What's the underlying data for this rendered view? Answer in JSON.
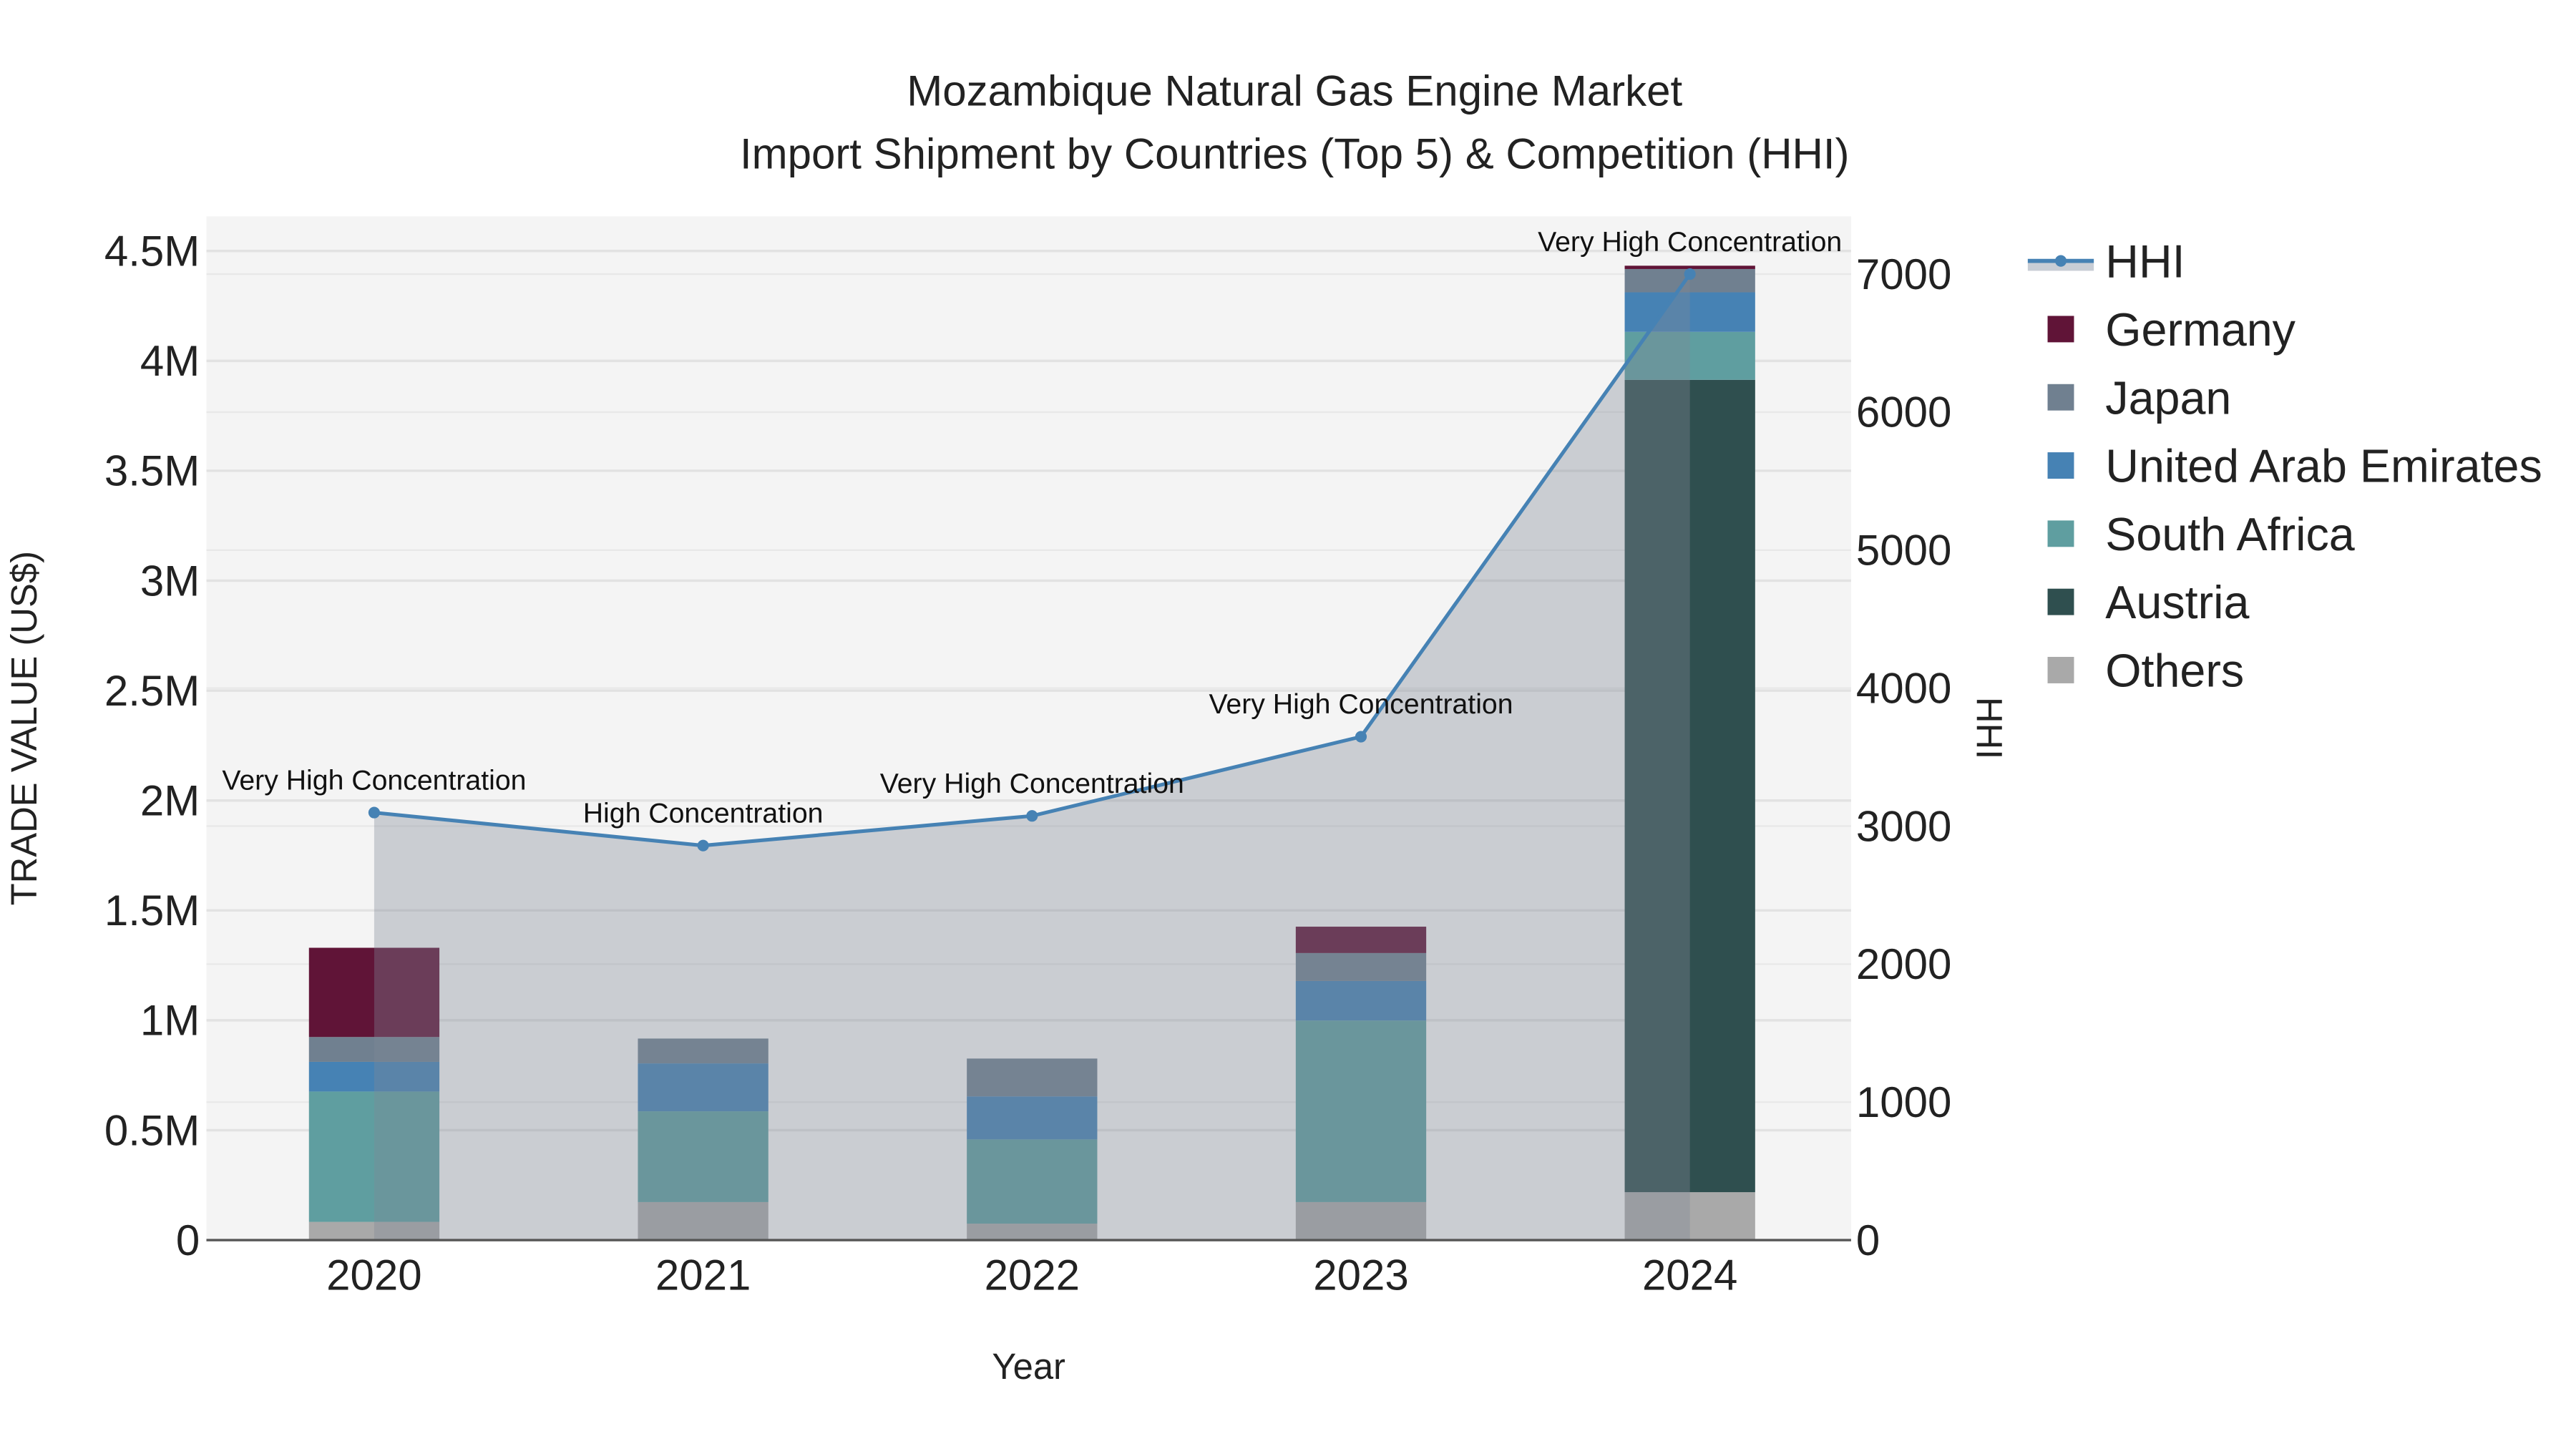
{
  "chart_data": {
    "type": "bar",
    "title": "Mozambique Natural Gas Engine Market",
    "subtitle": "Import Shipment by Countries (Top 5) & Competition (HHI)",
    "xlabel": "Year",
    "ylabel": "TRADE VALUE (US$)",
    "y2label": "HHI",
    "categories": [
      "2020",
      "2021",
      "2022",
      "2023",
      "2024"
    ],
    "ylim": [
      0,
      4650000
    ],
    "y2lim": [
      0,
      7400
    ],
    "yticks": [
      0,
      500000,
      1000000,
      1500000,
      2000000,
      2500000,
      3000000,
      3500000,
      4000000,
      4500000
    ],
    "yticklabels": [
      "0",
      "0.5M",
      "1M",
      "1.5M",
      "2M",
      "2.5M",
      "3M",
      "3.5M",
      "4M",
      "4.5M"
    ],
    "y2ticks": [
      0,
      1000,
      2000,
      3000,
      4000,
      5000,
      6000,
      7000
    ],
    "y2ticklabels": [
      "0",
      "1000",
      "2000",
      "3000",
      "4000",
      "5000",
      "6000",
      "7000"
    ],
    "grid": true,
    "legend_position": "right",
    "stacked_series": [
      {
        "name": "Others",
        "color": "#A9A9A9",
        "values": [
          83000,
          173000,
          75000,
          173000,
          218000
        ]
      },
      {
        "name": "Austria",
        "color": "#2F4F4F",
        "values": [
          0,
          0,
          0,
          0,
          3696000
        ]
      },
      {
        "name": "South Africa",
        "color": "#5F9EA0",
        "values": [
          593000,
          413000,
          383000,
          826000,
          218000
        ]
      },
      {
        "name": "United Arab Emirates",
        "color": "#4682B4",
        "values": [
          135000,
          218000,
          196000,
          180000,
          180000
        ]
      },
      {
        "name": "Japan",
        "color": "#708090",
        "values": [
          113000,
          113000,
          172000,
          127000,
          106000
        ]
      },
      {
        "name": "Germany",
        "color": "#601437",
        "values": [
          406000,
          0,
          0,
          120000,
          15000
        ]
      }
    ],
    "line_series": {
      "name": "HHI",
      "color": "#4682B4",
      "values": [
        3098,
        2859,
        3074,
        3648,
        7000
      ],
      "annotations": [
        "Very High Concentration",
        "High Concentration",
        "Very High Concentration",
        "Very High Concentration",
        "Very High Concentration"
      ]
    },
    "legend_order": [
      "HHI",
      "Germany",
      "Japan",
      "United Arab Emirates",
      "South Africa",
      "Austria",
      "Others"
    ]
  }
}
